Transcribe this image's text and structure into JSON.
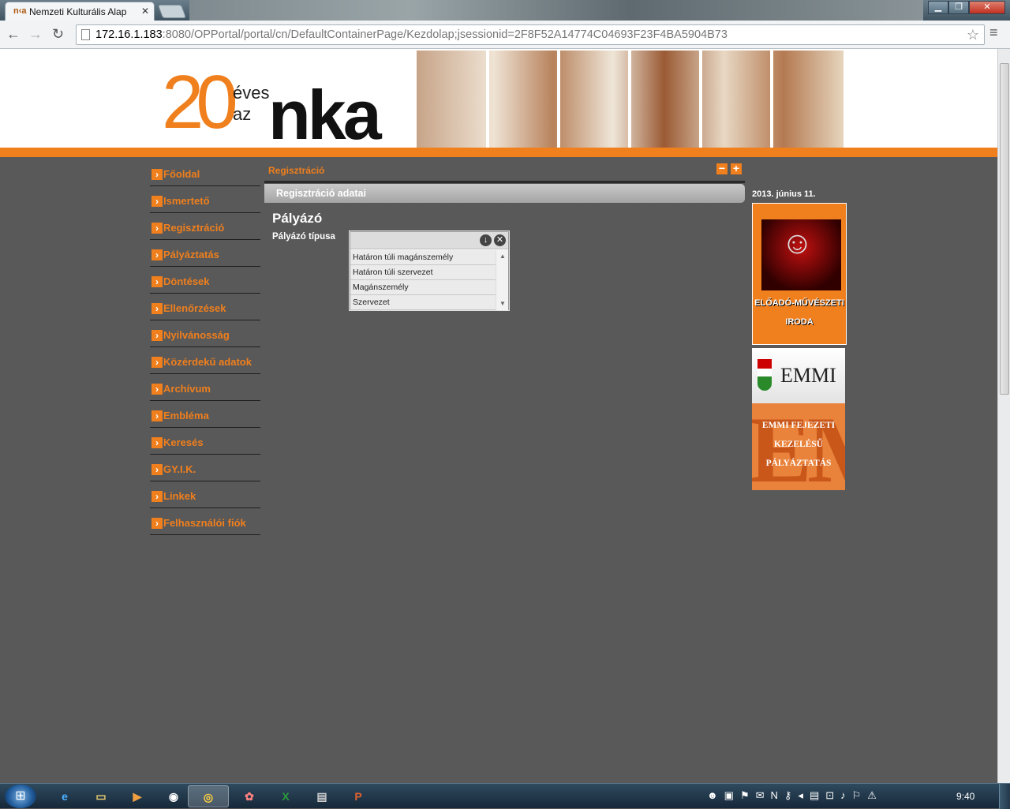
{
  "browser": {
    "tab_title": "Nemzeti Kulturális Alap",
    "tab_icon_text": "n‹a",
    "url_host": "172.16.1.183",
    "url_rest": ":8080/OPPortal/portal/cn/DefaultContainerPage/Kezdolap;jsessionid=2F8F52A14774C04693F23F4BA5904B73"
  },
  "header": {
    "logo_number": "20",
    "logo_eves": "éves",
    "logo_az": "az",
    "logo_nka": "nka"
  },
  "sidebar": {
    "items": [
      {
        "label": "Főoldal"
      },
      {
        "label": "Ismertető"
      },
      {
        "label": "Regisztráció"
      },
      {
        "label": "Pályáztatás"
      },
      {
        "label": "Döntések"
      },
      {
        "label": "Ellenőrzések"
      },
      {
        "label": "Nyilvánosság"
      },
      {
        "label": "Közérdekű adatok"
      },
      {
        "label": "Archívum"
      },
      {
        "label": "Embléma"
      },
      {
        "label": "Keresés"
      },
      {
        "label": "GY.I.K."
      },
      {
        "label": "Linkek"
      },
      {
        "label": "Felhasználói fiók"
      }
    ]
  },
  "main": {
    "breadcrumb": "Regisztráció",
    "section_title": "Regisztráció adatai",
    "heading": "Pályázó",
    "field_label": "Pályázó típusa",
    "dropdown_options": [
      "Határon túli magánszemély",
      "Határon túli szervezet",
      "Magánszemély",
      "Szervezet"
    ]
  },
  "right": {
    "date": "2013. június 11.",
    "banner1_line1": "ELŐADÓ-MŰVÉSZETI",
    "banner1_line2": "IRODA",
    "banner2_title": "EMMI",
    "banner3_line1": "EMMI FEJEZETI",
    "banner3_line2": "KEZELÉSŰ",
    "banner3_line3": "PÁLYÁZTATÁS",
    "banner3_bg": "EM"
  },
  "taskbar": {
    "clock": "9:40"
  },
  "colors": {
    "accent": "#f07f1d",
    "page_bg": "#595959"
  }
}
